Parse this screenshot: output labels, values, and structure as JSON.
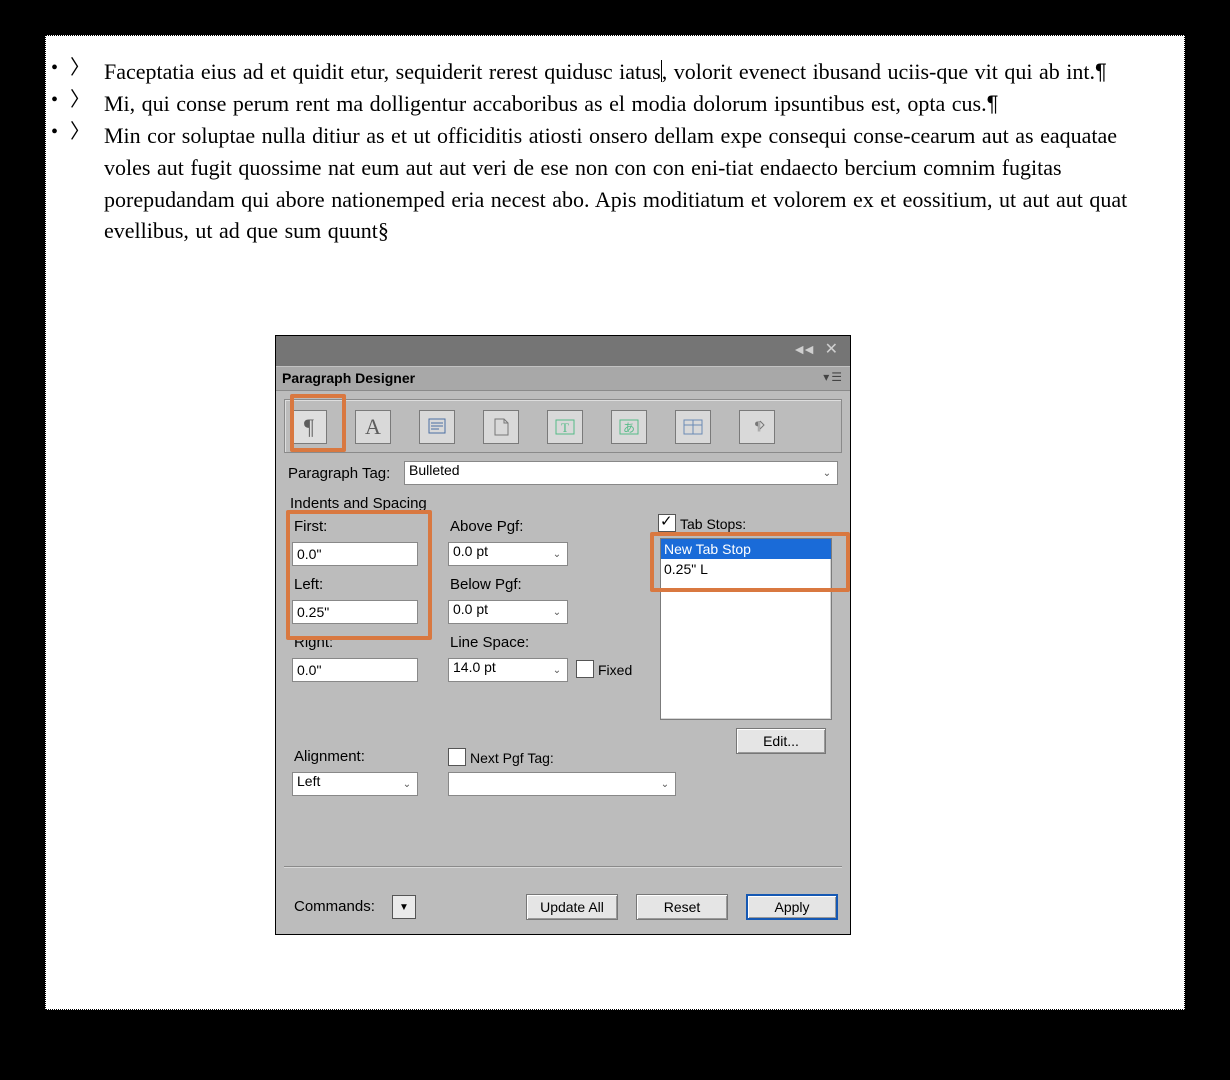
{
  "document": {
    "bullets": [
      {
        "text": "Faceptatia eius ad et quidit etur, sequiderit rerest quidusc iatus",
        "after_cursor": ", volorit evenect ibusand uciis-que vit qui ab int.",
        "has_cursor": true
      },
      {
        "text": "Mi, qui conse perum rent ma dolligentur accaboribus as el modia dolorum ipsuntibus est, opta cus."
      },
      {
        "text": "Min cor soluptae nulla ditiur as et ut officiditis atiosti onsero dellam expe consequi conse-cearum aut as eaquatae voles aut fugit quossime nat eum aut aut veri de ese non con con eni-tiat endaecto bercium comnim fugitas porepudandam qui abore nationemped eria necest abo. Apis moditiatum et volorem ex et eossitium, ut aut aut quat evellibus, ut ad que sum quunt",
        "end_mark": "§"
      }
    ],
    "pilcrow": "¶",
    "bullet_mark": "•",
    "tab_mark": "〉"
  },
  "dialog": {
    "title": "Paragraph Designer",
    "tabs": {
      "t0": "¶",
      "t1": "A"
    },
    "paragraph_tag_label": "Paragraph Tag:",
    "paragraph_tag_value": "Bulleted",
    "section_title": "Indents and Spacing",
    "first_label": "First:",
    "first_value": "0.0\"",
    "left_label": "Left:",
    "left_value": "0.25\"",
    "right_label": "Right:",
    "right_value": "0.0\"",
    "above_label": "Above Pgf:",
    "above_value": "0.0 pt",
    "below_label": "Below Pgf:",
    "below_value": "0.0 pt",
    "line_space_label": "Line Space:",
    "line_space_value": "14.0 pt",
    "fixed_label": "Fixed",
    "tab_stops_label": "Tab Stops:",
    "tab_stops_items": {
      "i0": "New Tab Stop",
      "i1": "0.25\"  L"
    },
    "edit_button": "Edit...",
    "alignment_label": "Alignment:",
    "alignment_value": "Left",
    "next_pgf_label": "Next Pgf Tag:",
    "next_pgf_value": "",
    "commands_label": "Commands:",
    "update_all": "Update All",
    "reset": "Reset",
    "apply": "Apply"
  }
}
